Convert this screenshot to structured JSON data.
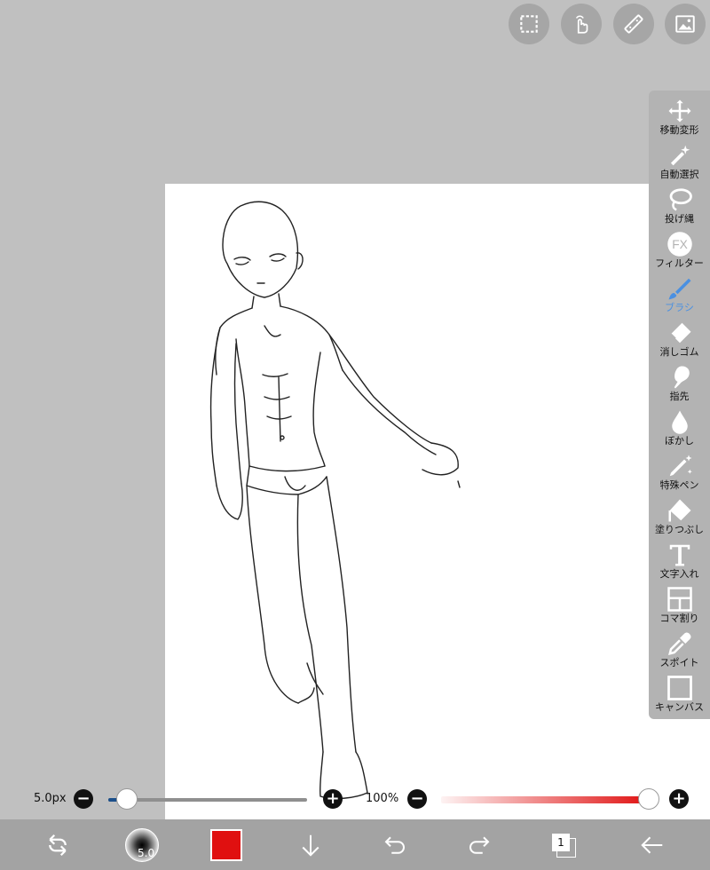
{
  "toolbar": {
    "tools": [
      {
        "label": "移動変形",
        "icon": "move-arrows-icon"
      },
      {
        "label": "自動選択",
        "icon": "magic-wand-icon"
      },
      {
        "label": "投げ縄",
        "icon": "lasso-icon"
      },
      {
        "label": "フィルター",
        "icon": "fx-filter-icon"
      },
      {
        "label": "ブラシ",
        "icon": "brush-icon",
        "active": true
      },
      {
        "label": "消しゴム",
        "icon": "eraser-icon"
      },
      {
        "label": "指先",
        "icon": "finger-smudge-icon"
      },
      {
        "label": "ぼかし",
        "icon": "blur-drop-icon"
      },
      {
        "label": "特殊ペン",
        "icon": "special-pen-icon"
      },
      {
        "label": "塗りつぶし",
        "icon": "bucket-fill-icon"
      },
      {
        "label": "文字入れ",
        "icon": "text-icon"
      },
      {
        "label": "コマ割り",
        "icon": "frame-divider-icon"
      },
      {
        "label": "スポイト",
        "icon": "eyedropper-icon"
      },
      {
        "label": "キャンバス",
        "icon": "canvas-icon"
      }
    ],
    "fx_text": "FX"
  },
  "top_buttons": [
    "selection-icon",
    "touch-gesture-icon",
    "ruler-icon",
    "material-image-icon"
  ],
  "brush_size": {
    "label": "5.0px",
    "level_fraction": 0.05
  },
  "opacity": {
    "label": "100%",
    "level_fraction": 1.0
  },
  "bottom": {
    "brush_preview_text": "5.0",
    "layer_count": "1",
    "color": "#e01010",
    "icons": [
      "rotate-tool-icon",
      "brush-preview-icon",
      "color-swatch",
      "download-arrow-icon",
      "undo-icon",
      "redo-icon",
      "layers-icon",
      "back-arrow-icon"
    ]
  },
  "colors": {
    "accent": "#4a90e2",
    "primary": "#e01010",
    "background": "#c0c0c0",
    "toolbar": "#b3b3b3"
  }
}
